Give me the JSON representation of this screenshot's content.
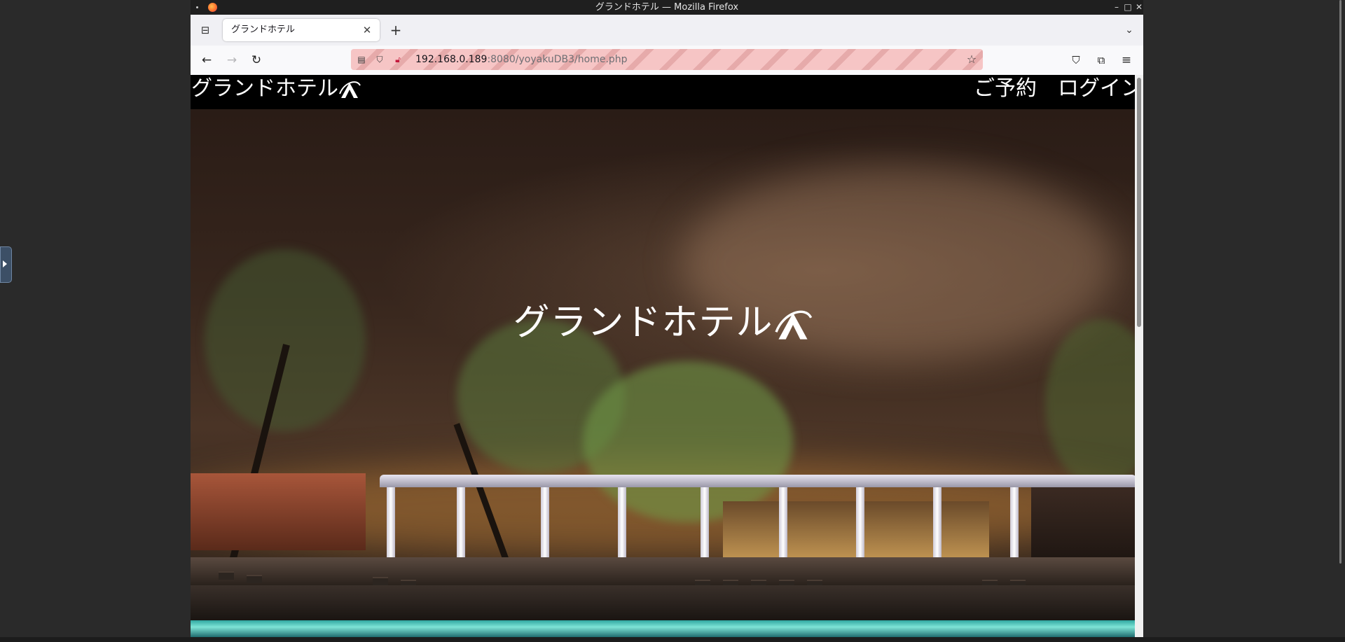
{
  "window": {
    "title": "グランドホテル — Mozilla Firefox"
  },
  "browser": {
    "tab": {
      "title": "グランドホテル"
    },
    "url": {
      "host": "192.168.0.189",
      "rest": ":8080/yoyakuDB3/home.php"
    }
  },
  "site": {
    "brand": "グランドホテル",
    "nav": {
      "reserve": "ご予約",
      "login": "ログイン"
    },
    "hero_title": "グランドホテル"
  },
  "icons": {
    "back": "arrow-left-icon",
    "forward": "arrow-right-icon",
    "reload": "reload-icon",
    "bookmark": "star-icon",
    "pocket": "pocket-icon",
    "extensions": "puzzle-icon",
    "menu": "hamburger-icon",
    "tab_list": "tab-list-icon",
    "new_tab": "plus-icon",
    "tab_close": "close-icon",
    "logo": "swoosh-a-logo"
  },
  "colors": {
    "header_bg": "#000000",
    "url_warning": "#f6c5c5",
    "text_on_dark": "#ffffff"
  }
}
